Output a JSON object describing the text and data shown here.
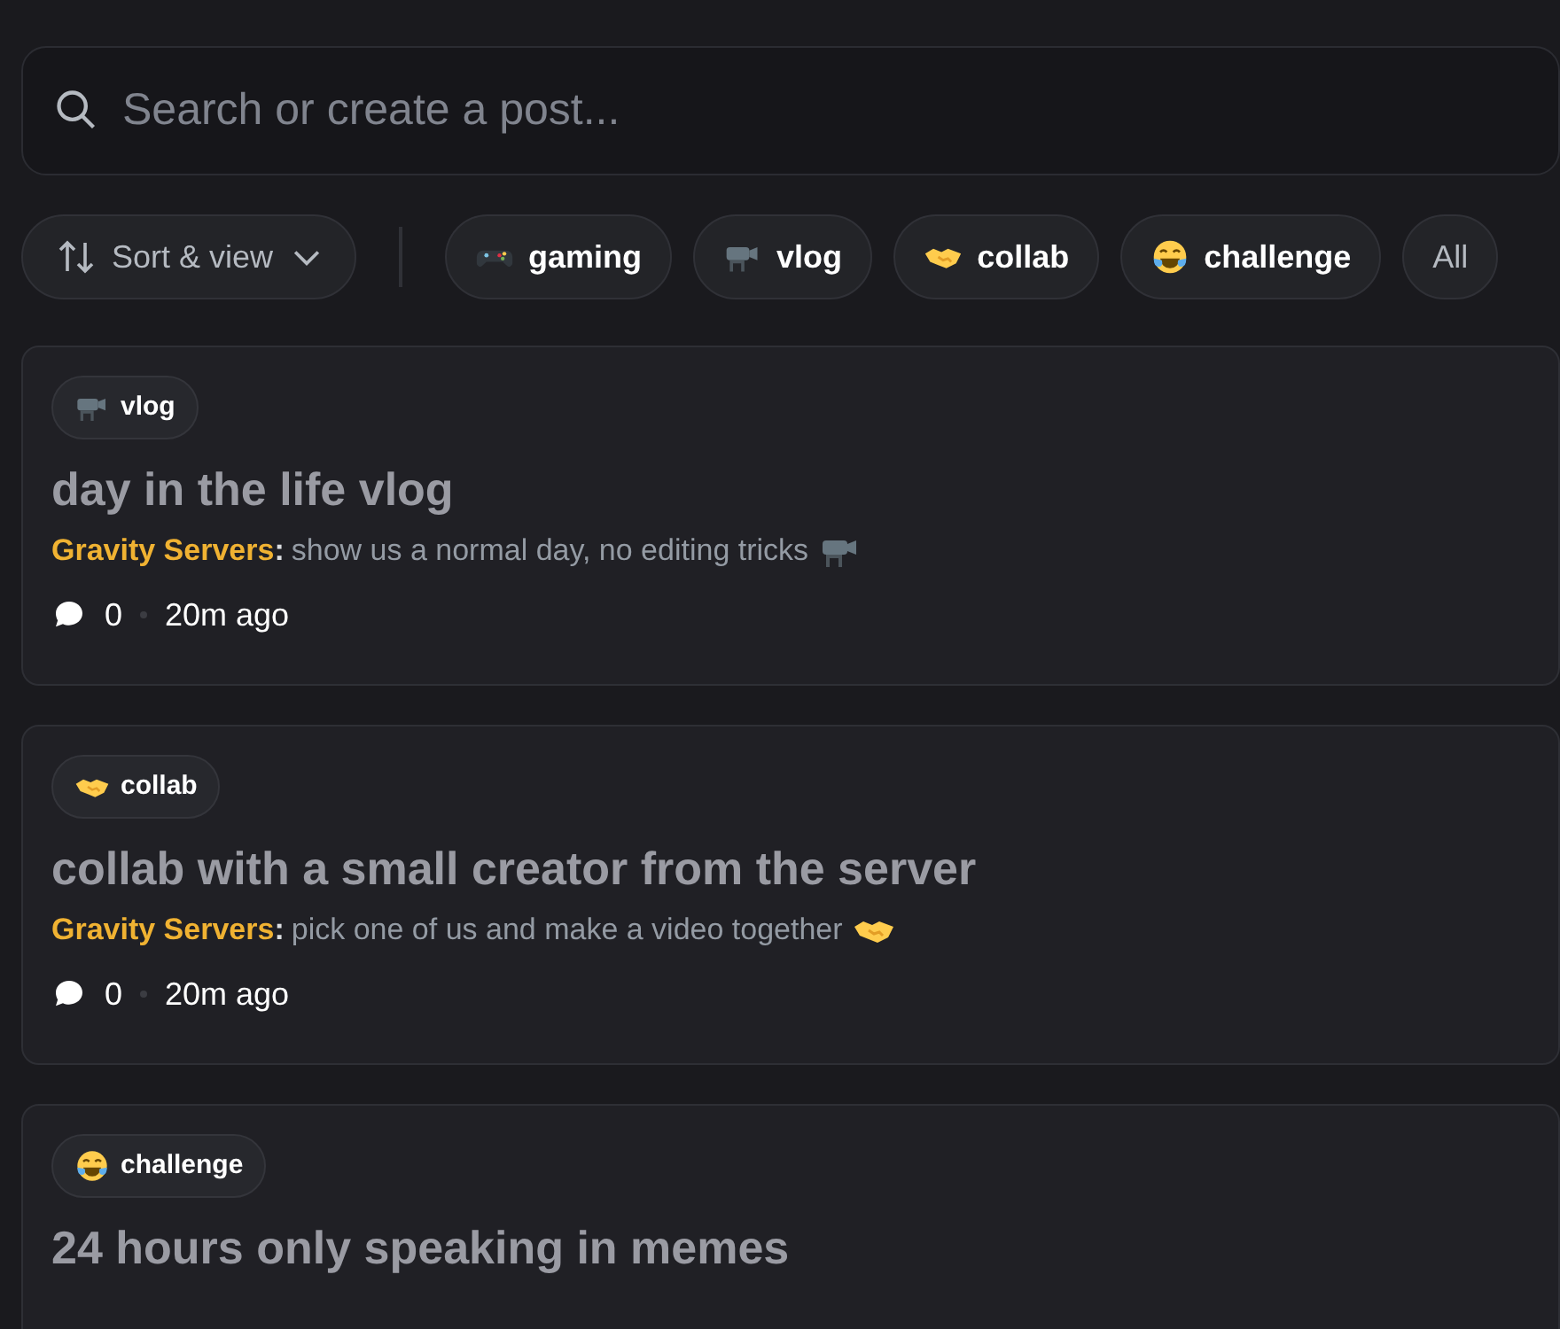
{
  "search": {
    "placeholder": "Search or create a post..."
  },
  "sort_button": {
    "label": "Sort & view"
  },
  "tag_filters": [
    {
      "label": "gaming",
      "kind": "gamepad"
    },
    {
      "label": "vlog",
      "kind": "camera"
    },
    {
      "label": "collab",
      "kind": "handshake"
    },
    {
      "label": "challenge",
      "kind": "laughing"
    },
    {
      "label": "All",
      "kind": "text"
    }
  ],
  "posts": [
    {
      "tag": {
        "label": "vlog",
        "kind": "camera"
      },
      "title": "day in the life vlog",
      "author": "Gravity Servers",
      "separator": ":",
      "message": "show us a normal day, no editing tricks",
      "comments": "0",
      "time": "20m ago"
    },
    {
      "tag": {
        "label": "collab",
        "kind": "handshake"
      },
      "title": "collab with a small creator from the server",
      "author": "Gravity Servers",
      "separator": ":",
      "message": "pick one of us and make a video together",
      "comments": "0",
      "time": "20m ago"
    },
    {
      "tag": {
        "label": "challenge",
        "kind": "laughing"
      },
      "title": "24 hours only speaking in memes"
    }
  ]
}
